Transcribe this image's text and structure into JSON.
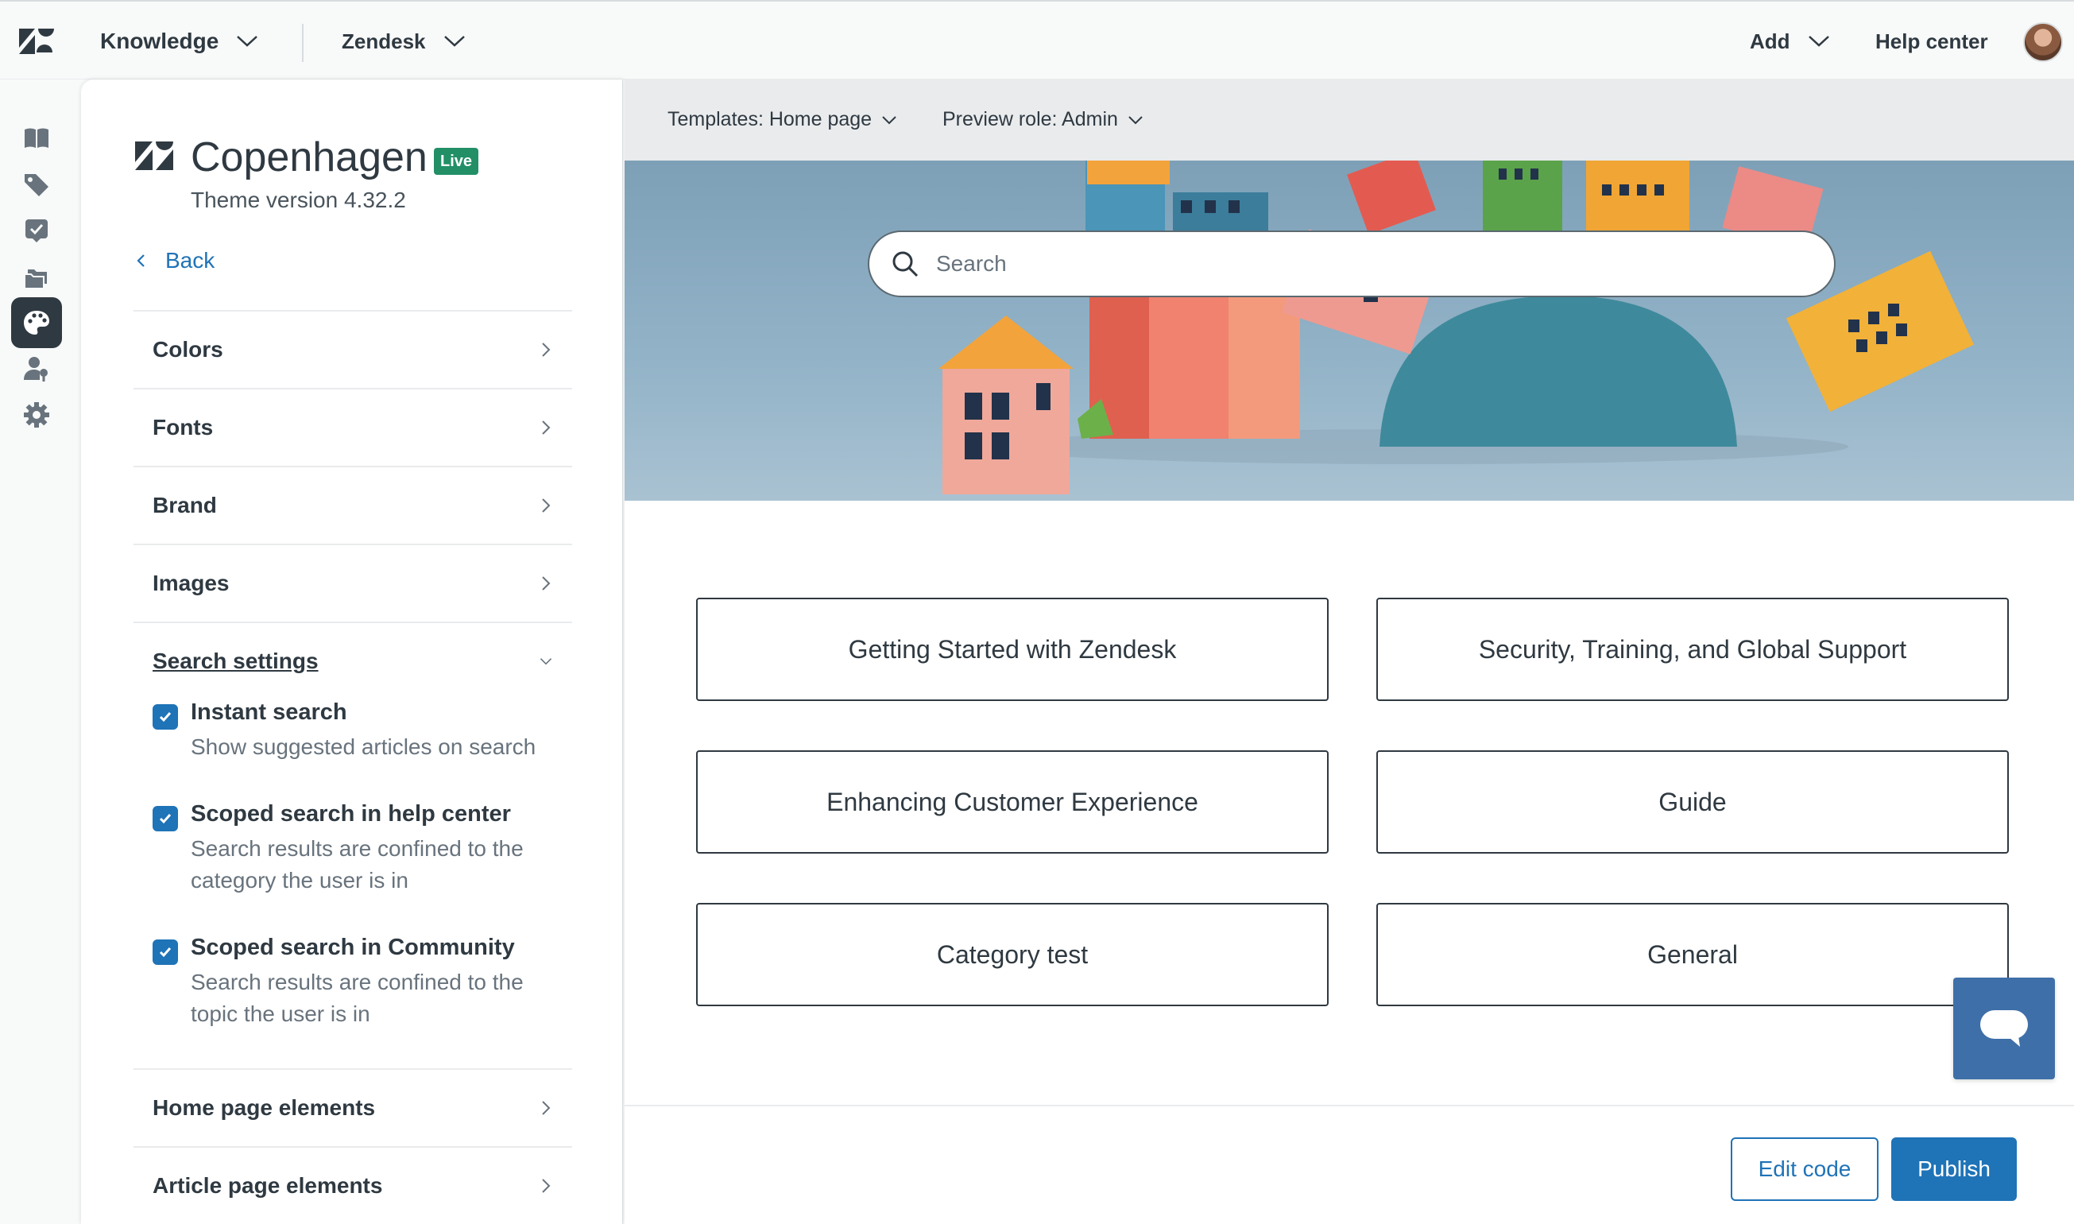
{
  "topbar": {
    "product_label": "Knowledge",
    "brand_label": "Zendesk",
    "add_label": "Add",
    "help_center_label": "Help center"
  },
  "rail": {
    "items": [
      "book-icon",
      "tag-icon",
      "checklist-icon",
      "folders-icon",
      "palette-icon",
      "user-permission-icon",
      "settings-gear-icon"
    ],
    "active_index": 4
  },
  "panel": {
    "theme_name": "Copenhagen",
    "live_badge": "Live",
    "theme_version": "Theme version 4.32.2",
    "back_label": "Back",
    "sections": {
      "colors": "Colors",
      "fonts": "Fonts",
      "brand": "Brand",
      "images": "Images",
      "search_settings": "Search settings",
      "home_page_elements": "Home page elements",
      "article_page_elements": "Article page elements"
    },
    "search_options": [
      {
        "title": "Instant search",
        "desc": "Show suggested articles on search",
        "checked": true
      },
      {
        "title": "Scoped search in help center",
        "desc": "Search results are confined to the category the user is in",
        "checked": true
      },
      {
        "title": "Scoped search in Community",
        "desc": "Search results are confined to the topic the user is in",
        "checked": true
      }
    ]
  },
  "preview": {
    "template_label": "Templates: Home page",
    "role_label": "Preview role: Admin",
    "search_placeholder": "Search",
    "categories": [
      "Getting Started with Zendesk",
      "Security, Training, and Global Support",
      "Enhancing Customer Experience",
      "Guide",
      "Category test",
      "General"
    ]
  },
  "footer": {
    "edit_code_label": "Edit code",
    "publish_label": "Publish"
  },
  "colors": {
    "primary": "#1f73b7",
    "live_badge": "#228f67",
    "text": "#2f3941",
    "chat_button": "#3e6fa8"
  }
}
